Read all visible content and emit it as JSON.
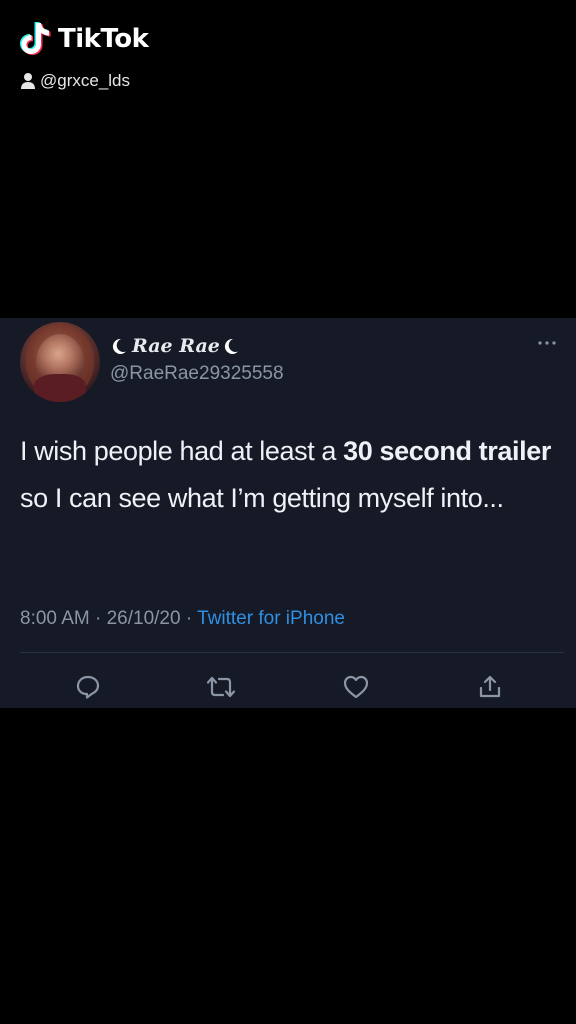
{
  "watermark": {
    "app_name": "TikTok",
    "handle": "@grxce_lds",
    "icons": [
      "tiktok-note-icon",
      "person-icon"
    ]
  },
  "tweet": {
    "display_name": "Rae Rae",
    "name_icons": [
      "crescent-moon-icon",
      "crescent-moon-icon"
    ],
    "username": "@RaeRae29325558",
    "text_parts": [
      {
        "text": "I wish people had at least a ",
        "bold": false
      },
      {
        "text": "30 second trailer",
        "bold": true
      },
      {
        "text": " so I can see what I’m getting myself into...",
        "bold": false
      }
    ],
    "time": "8:00 AM",
    "date": "26/10/20",
    "separator": " · ",
    "source": "Twitter for iPhone",
    "actions": [
      "reply-icon",
      "retweet-icon",
      "like-icon",
      "share-icon"
    ]
  },
  "colors": {
    "background": "#000000",
    "card": "#151a26",
    "text": "#eef1f5",
    "muted": "#8b95a5",
    "link": "#2f8fe3"
  }
}
